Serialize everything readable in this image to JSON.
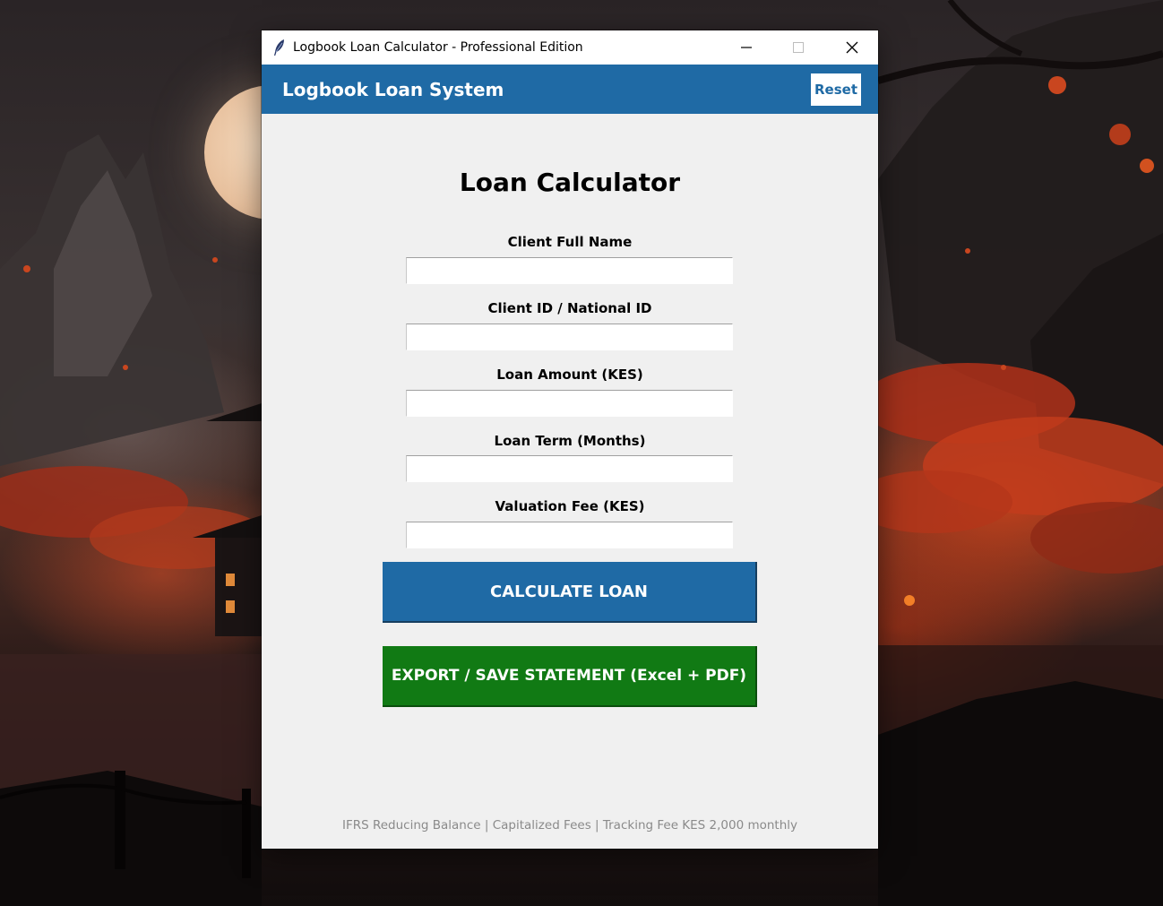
{
  "window": {
    "title": "Logbook Loan Calculator - Professional Edition",
    "app_icon": "feather-icon",
    "controls": [
      "minimize-icon",
      "maximize-icon",
      "close-icon"
    ]
  },
  "header": {
    "title": "Logbook Loan System",
    "reset_label": "Reset",
    "background_color": "#1f6aa5"
  },
  "form": {
    "title": "Loan Calculator",
    "fields": [
      {
        "label": "Client Full Name",
        "value": ""
      },
      {
        "label": "Client ID / National ID",
        "value": ""
      },
      {
        "label": "Loan Amount (KES)",
        "value": ""
      },
      {
        "label": "Loan Term (Months)",
        "value": ""
      },
      {
        "label": "Valuation Fee (KES)",
        "value": ""
      }
    ]
  },
  "actions": {
    "calculate_label": "CALCULATE LOAN",
    "calculate_color": "#1f6aa5",
    "export_label": "EXPORT / SAVE STATEMENT (Excel + PDF)",
    "export_color": "#117a14"
  },
  "footer": {
    "text": "IFRS Reducing Balance | Capitalized Fees | Tracking Fee KES 2,000 monthly"
  }
}
